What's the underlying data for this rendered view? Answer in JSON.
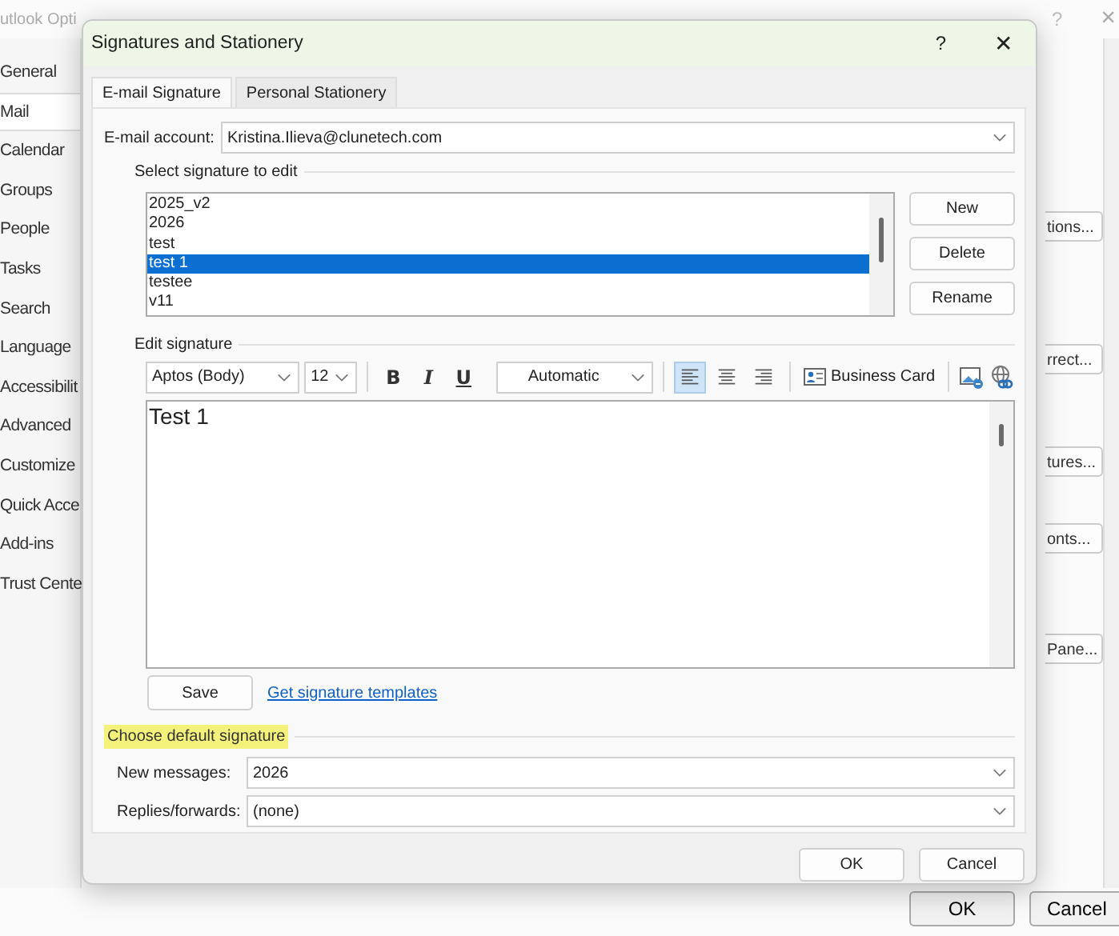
{
  "background_window": {
    "title": "utlook Opti",
    "help": "?",
    "close": "×",
    "nav": [
      {
        "label": "General",
        "selected": false
      },
      {
        "label": "Mail",
        "selected": true
      },
      {
        "label": "Calendar",
        "selected": false
      },
      {
        "label": "Groups",
        "selected": false
      },
      {
        "label": "People",
        "selected": false
      },
      {
        "label": "Tasks",
        "selected": false
      },
      {
        "label": "Search",
        "selected": false
      },
      {
        "label": "Language",
        "selected": false
      },
      {
        "label": "Accessibilit",
        "selected": false
      },
      {
        "label": "Advanced",
        "selected": false
      },
      {
        "label": "Customize",
        "selected": false
      },
      {
        "label": "Quick Acce",
        "selected": false
      },
      {
        "label": "Add-ins",
        "selected": false
      },
      {
        "label": "Trust Cente",
        "selected": false
      }
    ],
    "side_buttons": [
      "tions...",
      "rrect...",
      "tures...",
      "onts...",
      "Pane..."
    ],
    "footer_buttons": [
      "OK",
      "Cancel"
    ]
  },
  "dialog": {
    "title": "Signatures and Stationery",
    "help": "?",
    "close": "✕",
    "tabs": [
      {
        "label": "E-mail Signature",
        "selected": true
      },
      {
        "label": "Personal Stationery",
        "selected": false
      }
    ],
    "email_account": {
      "label": "E-mail account:",
      "value": "Kristina.Ilieva@clunetech.com"
    },
    "select_label": "Select signature to edit",
    "signatures": [
      {
        "name": "2025_v2",
        "selected": false
      },
      {
        "name": "2026",
        "selected": false
      },
      {
        "name": "test",
        "selected": false
      },
      {
        "name": "test 1",
        "selected": true
      },
      {
        "name": "testee",
        "selected": false
      },
      {
        "name": "v11",
        "selected": false
      }
    ],
    "list_buttons": [
      "New",
      "Delete",
      "Rename"
    ],
    "edit_label": "Edit signature",
    "toolbar": {
      "font": "Aptos (Body)",
      "size": "12",
      "bold": "B",
      "italic": "I",
      "underline": "U",
      "font_color": "Automatic",
      "align": [
        {
          "kind": "left",
          "selected": true
        },
        {
          "kind": "center",
          "selected": false
        },
        {
          "kind": "right",
          "selected": false
        }
      ],
      "business_card": "Business Card"
    },
    "editor_text": "Test 1",
    "save": "Save",
    "templates_link": "Get signature templates",
    "default_section": {
      "label": "Choose default signature",
      "highlighted": true
    },
    "defaults": [
      {
        "label": "New messages:",
        "value": "2026"
      },
      {
        "label": "Replies/forwards:",
        "value": "(none)"
      }
    ],
    "buttons": [
      "OK",
      "Cancel"
    ]
  }
}
